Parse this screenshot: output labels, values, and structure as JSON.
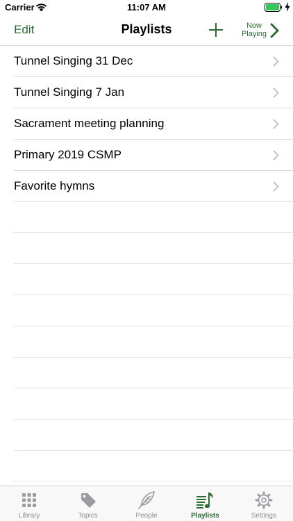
{
  "status_bar": {
    "carrier": "Carrier",
    "time": "11:07 AM"
  },
  "nav": {
    "edit_label": "Edit",
    "title": "Playlists",
    "now_playing_line1": "Now",
    "now_playing_line2": "Playing"
  },
  "playlists": [
    {
      "label": "Tunnel Singing 31 Dec"
    },
    {
      "label": "Tunnel Singing 7 Jan"
    },
    {
      "label": "Sacrament meeting planning"
    },
    {
      "label": "Primary 2019 CSMP"
    },
    {
      "label": "Favorite hymns"
    }
  ],
  "tabs": [
    {
      "label": "Library",
      "icon": "grid-icon",
      "active": false
    },
    {
      "label": "Topics",
      "icon": "tag-icon",
      "active": false
    },
    {
      "label": "People",
      "icon": "feather-icon",
      "active": false
    },
    {
      "label": "Playlists",
      "icon": "playlist-music-icon",
      "active": true
    },
    {
      "label": "Settings",
      "icon": "gear-icon",
      "active": false
    }
  ],
  "colors": {
    "accent": "#2c6b34",
    "inactive_tab": "#8e8e93",
    "separator": "#d9d9d9"
  }
}
